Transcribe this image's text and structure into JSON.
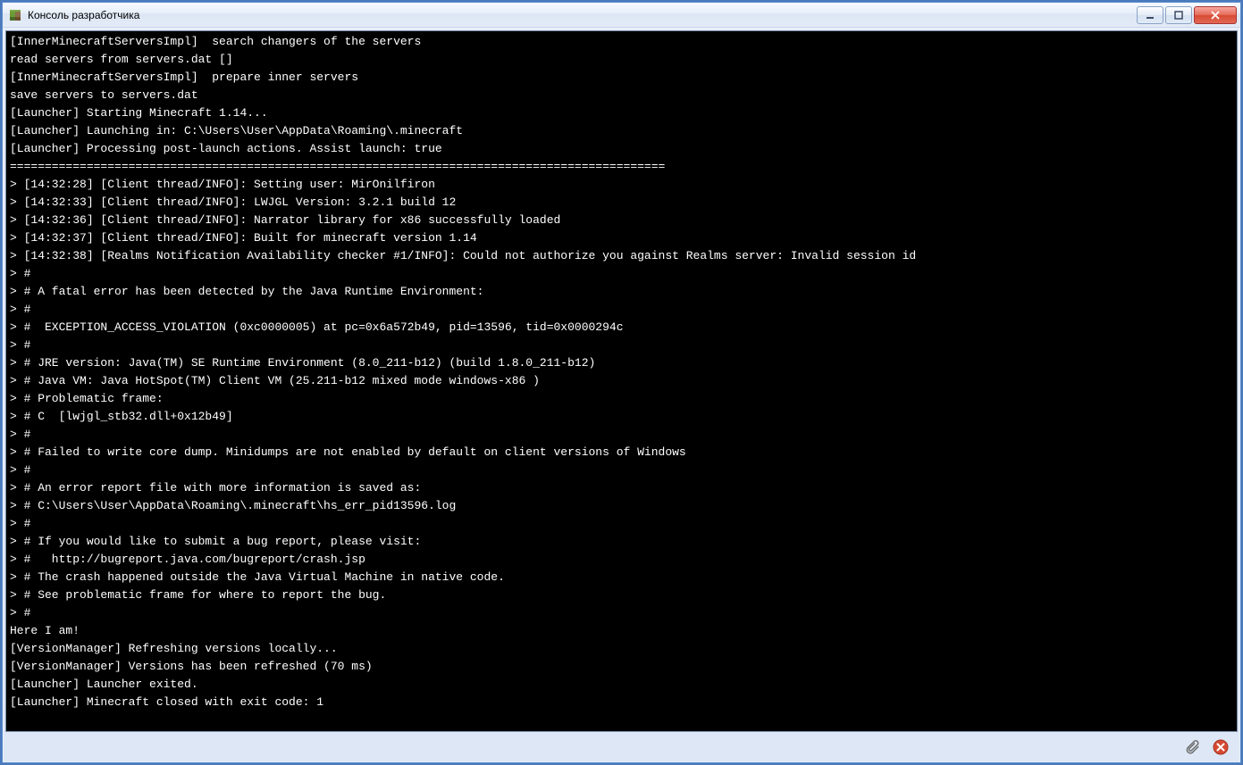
{
  "window": {
    "title": "Консоль разработчика"
  },
  "console": {
    "lines": [
      "[InnerMinecraftServersImpl]  search changers of the servers",
      "read servers from servers.dat []",
      "[InnerMinecraftServersImpl]  prepare inner servers",
      "save servers to servers.dat",
      "[Launcher] Starting Minecraft 1.14...",
      "[Launcher] Launching in: C:\\Users\\User\\AppData\\Roaming\\.minecraft",
      "[Launcher] Processing post-launch actions. Assist launch: true",
      "==============================================================================================",
      "> [14:32:28] [Client thread/INFO]: Setting user: MirOnilfiron",
      "> [14:32:33] [Client thread/INFO]: LWJGL Version: 3.2.1 build 12",
      "> [14:32:36] [Client thread/INFO]: Narrator library for x86 successfully loaded",
      "> [14:32:37] [Client thread/INFO]: Built for minecraft version 1.14",
      "> [14:32:38] [Realms Notification Availability checker #1/INFO]: Could not authorize you against Realms server: Invalid session id",
      "> #",
      "> # A fatal error has been detected by the Java Runtime Environment:",
      "> #",
      "> #  EXCEPTION_ACCESS_VIOLATION (0xc0000005) at pc=0x6a572b49, pid=13596, tid=0x0000294c",
      "> #",
      "> # JRE version: Java(TM) SE Runtime Environment (8.0_211-b12) (build 1.8.0_211-b12)",
      "> # Java VM: Java HotSpot(TM) Client VM (25.211-b12 mixed mode windows-x86 )",
      "> # Problematic frame:",
      "> # C  [lwjgl_stb32.dll+0x12b49]",
      "> #",
      "> # Failed to write core dump. Minidumps are not enabled by default on client versions of Windows",
      "> #",
      "> # An error report file with more information is saved as:",
      "> # C:\\Users\\User\\AppData\\Roaming\\.minecraft\\hs_err_pid13596.log",
      "> #",
      "> # If you would like to submit a bug report, please visit:",
      "> #   http://bugreport.java.com/bugreport/crash.jsp",
      "> # The crash happened outside the Java Virtual Machine in native code.",
      "> # See problematic frame for where to report the bug.",
      "> #",
      "Here I am!",
      "[VersionManager] Refreshing versions locally...",
      "[VersionManager] Versions has been refreshed (70 ms)",
      "[Launcher] Launcher exited.",
      "[Launcher] Minecraft closed with exit code: 1"
    ]
  },
  "status": {
    "attach_icon": "paperclip-icon",
    "close_icon": "close-circle-icon"
  }
}
